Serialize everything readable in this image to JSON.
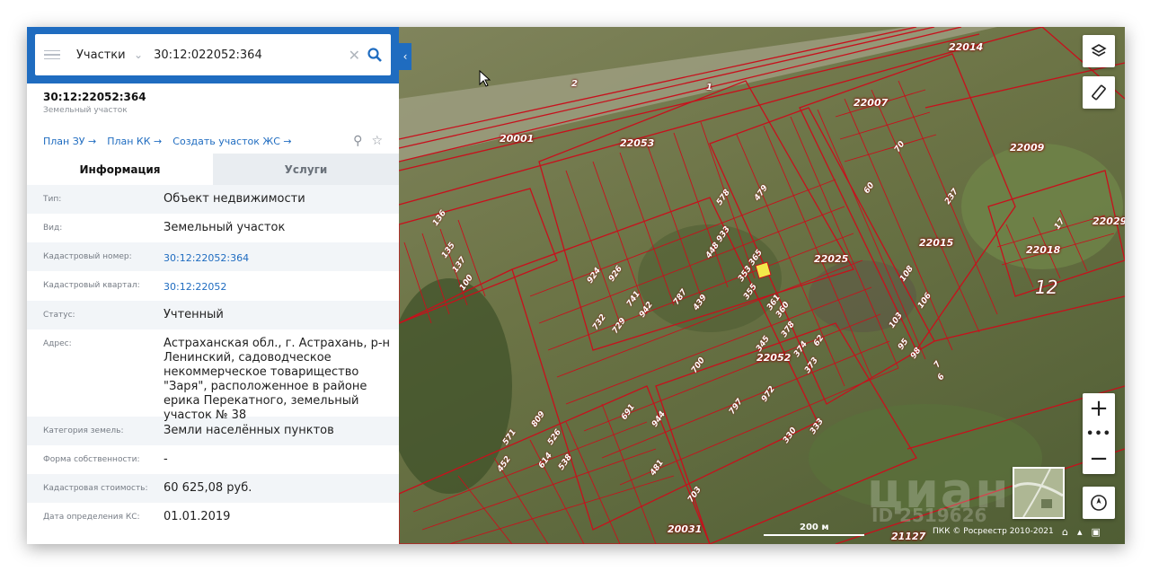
{
  "search": {
    "layer": "Участки",
    "query": "30:12:022052:364",
    "clear_icon": "close-icon",
    "search_icon": "search-icon"
  },
  "object": {
    "title": "30:12:22052:364",
    "subtitle": "Земельный участок"
  },
  "links": [
    "План ЗУ →",
    "План КК →",
    "Создать участок ЖС →"
  ],
  "tabs": [
    {
      "label": "Информация",
      "active": true
    },
    {
      "label": "Услуги",
      "active": false
    }
  ],
  "info": [
    {
      "key": "Тип:",
      "value": "Объект недвижимости"
    },
    {
      "key": "Вид:",
      "value": "Земельный участок"
    },
    {
      "key": "Кадастровый номер:",
      "value": "30:12:22052:364"
    },
    {
      "key": "Кадастровый квартал:",
      "value": "30:12:22052"
    },
    {
      "key": "Статус:",
      "value": "Учтенный"
    },
    {
      "key": "Адрес:",
      "value": "Астраханская обл., г. Астрахань, р-н Ленинский, садоводческое некоммерческое товарищество \"Заря\", расположенное в районе ерика Перекатного, земельный участок № 38"
    },
    {
      "key": "Категория земель:",
      "value": "Земли населённых пунктов"
    },
    {
      "key": "Форма собственности:",
      "value": "-"
    },
    {
      "key": "Кадастровая стоимость:",
      "value": "60 625,08 руб."
    },
    {
      "key": "Дата определения КС:",
      "value": "01.01.2019"
    }
  ],
  "map": {
    "quarters": [
      "20001",
      "22053",
      "22014",
      "22007",
      "22009",
      "22029",
      "22015",
      "22018",
      "22025",
      "22052",
      "21127",
      "20031"
    ],
    "parcels": [
      "2",
      "1",
      "12",
      "578",
      "479",
      "933",
      "448",
      "365",
      "353",
      "355",
      "361",
      "360",
      "378",
      "345",
      "374",
      "373",
      "700",
      "797",
      "972",
      "330",
      "333",
      "809",
      "571",
      "614",
      "526",
      "452",
      "538",
      "481",
      "944",
      "703",
      "691",
      "732",
      "729",
      "942",
      "787",
      "439",
      "924",
      "926",
      "741",
      "100",
      "137",
      "135",
      "136",
      "70",
      "60",
      "62",
      "237",
      "17",
      "7",
      "6",
      "108",
      "106",
      "103",
      "95",
      "98"
    ],
    "scale": "200 м",
    "attribution": "ПКК © Росреестр 2010-2021",
    "watermark": "циан",
    "watermark_id": "ID 2519626",
    "buttons": [
      "layers-icon",
      "ruler-icon",
      "zoom-in",
      "more",
      "zoom-out",
      "compass-icon"
    ],
    "zoom_in": "+",
    "zoom_more": "•••",
    "zoom_out": "−"
  },
  "colors": {
    "accent": "#1f6cc0",
    "parcel_line": "#c0101a",
    "highlight": "#f2e94a"
  }
}
